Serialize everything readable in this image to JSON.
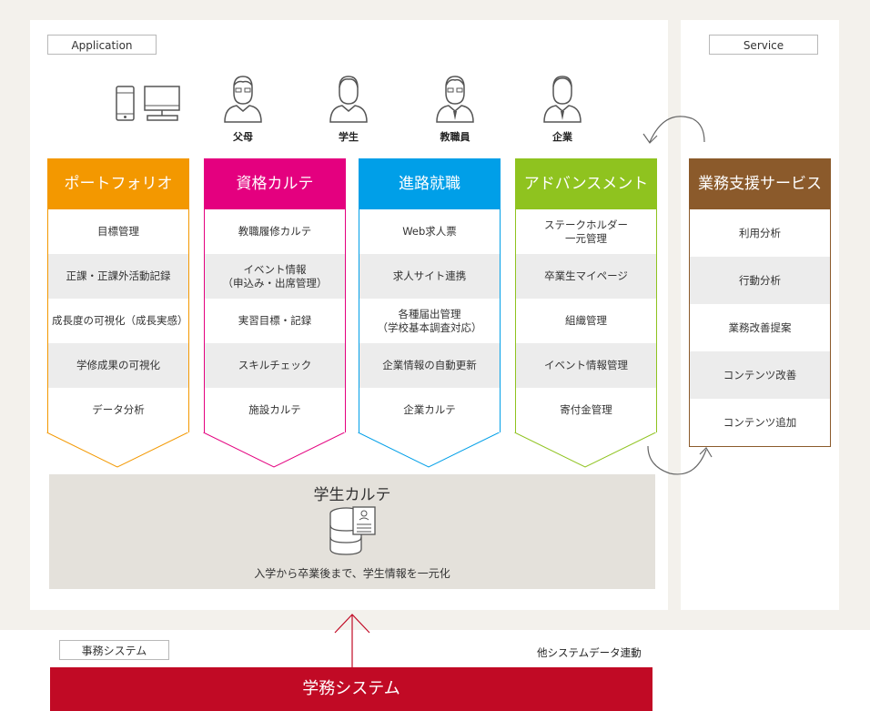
{
  "tags": {
    "application": "Application",
    "service": "Service",
    "jimu": "事務システム"
  },
  "users": [
    {
      "label": "父母",
      "icon": "parent-icon"
    },
    {
      "label": "学生",
      "icon": "student-icon"
    },
    {
      "label": "教職員",
      "icon": "faculty-icon"
    },
    {
      "label": "企業",
      "icon": "company-icon"
    }
  ],
  "columns": [
    {
      "title": "ポートフォリオ",
      "color": "#f39800",
      "items": [
        "目標管理",
        "正課・正課外活動記録",
        "成長度の可視化（成長実感）",
        "学修成果の可視化",
        "データ分析"
      ]
    },
    {
      "title": "資格カルテ",
      "color": "#e4007f",
      "items": [
        "教職履修カルテ",
        "イベント情報\n（申込み・出席管理）",
        "実習目標・記録",
        "スキルチェック",
        "施設カルテ"
      ]
    },
    {
      "title": "進路就職",
      "color": "#009fe8",
      "items": [
        "Web求人票",
        "求人サイト連携",
        "各種届出管理\n（学校基本調査対応）",
        "企業情報の自動更新",
        "企業カルテ"
      ]
    },
    {
      "title": "アドバンスメント",
      "color": "#8fc31f",
      "items": [
        "ステークホルダー\n一元管理",
        "卒業生マイページ",
        "組織管理",
        "イベント情報管理",
        "寄付金管理"
      ]
    }
  ],
  "service": {
    "title": "業務支援サービス",
    "color": "#8b5a2b",
    "items": [
      "利用分析",
      "行動分析",
      "業務改善提案",
      "コンテンツ改善",
      "コンテンツ追加"
    ]
  },
  "karte": {
    "title": "学生カルテ",
    "subtitle": "入学から卒業後まで、学生情報を一元化"
  },
  "link_label": "他システムデータ連動",
  "gakumu": "学務システム"
}
